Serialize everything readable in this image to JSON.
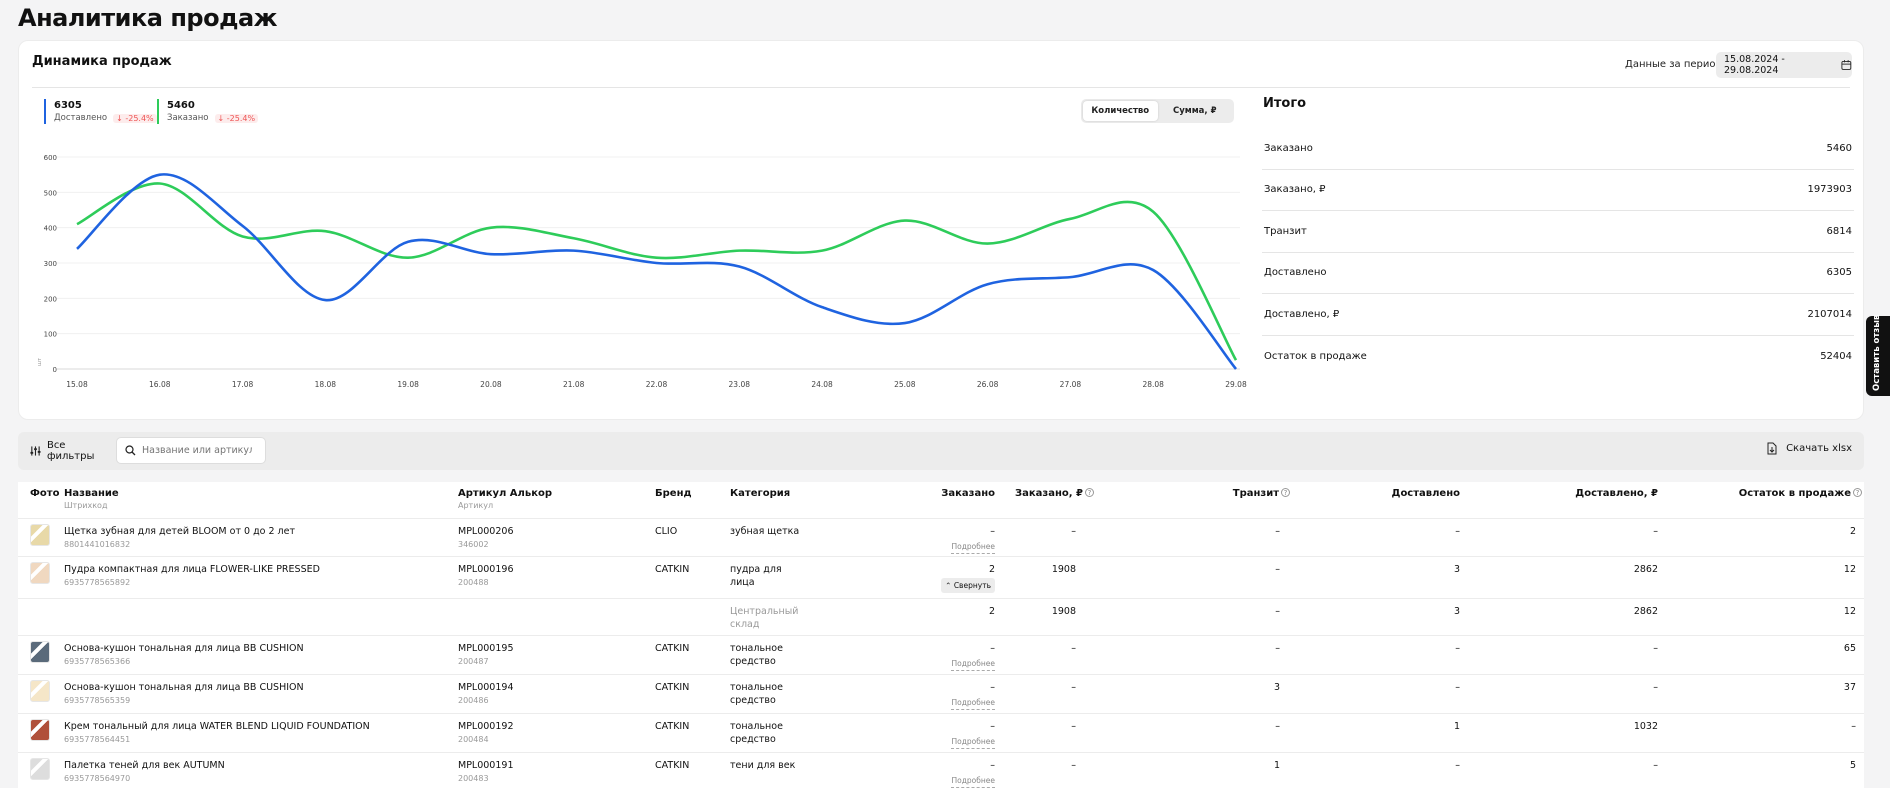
{
  "page": {
    "title": "Аналитика продаж"
  },
  "dynamics": {
    "title": "Динамика продаж",
    "period_label": "Данные за период",
    "period_value": "15.08.2024 - 29.08.2024",
    "legend": [
      {
        "value": "6305",
        "label": "Доставлено",
        "delta": "↓ -25.4%",
        "color": "#1f63e0"
      },
      {
        "value": "5460",
        "label": "Заказано",
        "delta": "↓ -25.4%",
        "color": "#2ecc5a"
      }
    ],
    "toggle": {
      "options": [
        "Количество",
        "Сумма, ₽"
      ],
      "active": "Количество"
    }
  },
  "chart_data": {
    "type": "line",
    "x": [
      "15.08",
      "16.08",
      "17.08",
      "18.08",
      "19.08",
      "20.08",
      "21.08",
      "22.08",
      "23.08",
      "24.08",
      "25.08",
      "26.08",
      "27.08",
      "28.08",
      "29.08"
    ],
    "y_ticks": [
      "0",
      "100",
      "200",
      "300",
      "400",
      "500",
      "600"
    ],
    "ylim": [
      0,
      600
    ],
    "ylabel": "шт",
    "grid": true,
    "series": [
      {
        "name": "Доставлено",
        "color": "#1f63e0",
        "values": [
          340,
          550,
          405,
          195,
          360,
          325,
          335,
          300,
          290,
          175,
          130,
          240,
          260,
          280,
          0
        ]
      },
      {
        "name": "Заказано",
        "color": "#2ecc5a",
        "values": [
          410,
          525,
          375,
          390,
          315,
          400,
          370,
          315,
          335,
          335,
          420,
          355,
          425,
          445,
          25
        ]
      }
    ]
  },
  "totals": {
    "title": "Итого",
    "rows": [
      {
        "label": "Заказано",
        "value": "5460"
      },
      {
        "label": "Заказано, ₽",
        "value": "1973903"
      },
      {
        "label": "Транзит",
        "value": "6814"
      },
      {
        "label": "Доставлено",
        "value": "6305"
      },
      {
        "label": "Доставлено, ₽",
        "value": "2107014"
      },
      {
        "label": "Остаток в продаже",
        "value": "52404"
      }
    ]
  },
  "toolbar": {
    "filters_label": "Все фильтры",
    "search_placeholder": "Название или артикул",
    "download_label": "Скачать xlsx"
  },
  "table": {
    "headers": {
      "photo": "Фото",
      "name": "Название",
      "name_sub": "Штрихкод",
      "article": "Артикул Алькор",
      "article_sub": "Артикул",
      "brand": "Бренд",
      "category": "Категория",
      "ordered": "Заказано",
      "ordered_rub": "Заказано, ₽",
      "transit": "Транзит",
      "delivered": "Доставлено",
      "delivered_rub": "Доставлено, ₽",
      "stock": "Остаток в продаже"
    },
    "more_label": "Подробнее",
    "collapse_label": "⌃ Свернуть",
    "rows": [
      {
        "name": "Щетка зубная для детей BLOOM от 0 до 2 лет",
        "barcode": "8801441016832",
        "article": "MPL000206",
        "article_sub": "346002",
        "brand": "CLIO",
        "category": "зубная щетка",
        "category2": "",
        "ordered": "–",
        "ordered_rub": "–",
        "transit": "–",
        "delivered": "–",
        "delivered_rub": "–",
        "stock": "2"
      },
      {
        "name": "Пудра компактная для лица FLOWER-LIKE PRESSED",
        "barcode": "6935778565892",
        "article": "MPL000196",
        "article_sub": "200488",
        "brand": "CATKIN",
        "category": "пудра для",
        "category2": "лица",
        "ordered": "2",
        "ordered_rub": "1908",
        "transit": "–",
        "delivered": "3",
        "delivered_rub": "2862",
        "stock": "12"
      },
      {
        "category": "Центральный",
        "category2": "склад",
        "ordered": "2",
        "ordered_rub": "1908",
        "transit": "–",
        "delivered": "3",
        "delivered_rub": "2862",
        "stock": "12"
      },
      {
        "name": "Основа-кушон тональная для лица BB CUSHION",
        "barcode": "6935778565366",
        "article": "MPL000195",
        "article_sub": "200487",
        "brand": "CATKIN",
        "category": "тональное",
        "category2": "средство",
        "ordered": "–",
        "ordered_rub": "–",
        "transit": "–",
        "delivered": "–",
        "delivered_rub": "–",
        "stock": "65"
      },
      {
        "name": "Основа-кушон тональная для лица BB CUSHION",
        "barcode": "6935778565359",
        "article": "MPL000194",
        "article_sub": "200486",
        "brand": "CATKIN",
        "category": "тональное",
        "category2": "средство",
        "ordered": "–",
        "ordered_rub": "–",
        "transit": "3",
        "delivered": "–",
        "delivered_rub": "–",
        "stock": "37"
      },
      {
        "name": "Крем тональный для лица WATER BLEND LIQUID FOUNDATION",
        "barcode": "6935778564451",
        "article": "MPL000192",
        "article_sub": "200484",
        "brand": "CATKIN",
        "category": "тональное",
        "category2": "средство",
        "ordered": "–",
        "ordered_rub": "–",
        "transit": "–",
        "delivered": "1",
        "delivered_rub": "1032",
        "stock": "–"
      },
      {
        "name": "Палетка теней для век AUTUMN",
        "barcode": "6935778564970",
        "article": "MPL000191",
        "article_sub": "200483",
        "brand": "CATKIN",
        "category": "тени для век",
        "category2": "",
        "ordered": "–",
        "ordered_rub": "–",
        "transit": "1",
        "delivered": "–",
        "delivered_rub": "–",
        "stock": "5"
      }
    ]
  },
  "feedback": {
    "label": "Оставить отзыв"
  }
}
